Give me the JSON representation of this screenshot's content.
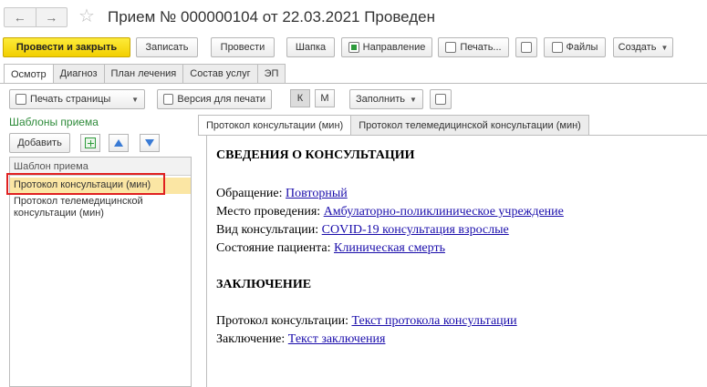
{
  "window": {
    "title": "Прием № 000000104 от 22.03.2021 Проведен"
  },
  "nav": {
    "back": "←",
    "forward": "→"
  },
  "toolbar": {
    "post_close": "Провести и закрыть",
    "save": "Записать",
    "post": "Провести",
    "header": "Шапка",
    "direction": "Направление",
    "print": "Печать...",
    "files": "Файлы",
    "create": "Создать"
  },
  "tabs": [
    "Осмотр",
    "Диагноз",
    "План лечения",
    "Состав услуг",
    "ЭП"
  ],
  "toolbar2": {
    "print_page": "Печать страницы",
    "print_version": "Версия для печати",
    "k": "К",
    "m": "М",
    "fill": "Заполнить"
  },
  "templates": {
    "title": "Шаблоны приема",
    "add": "Добавить",
    "column": "Шаблон приема",
    "items": [
      "Протокол консультации (мин)",
      "Протокол телемедицинской консультации (мин)"
    ]
  },
  "doc_tabs": [
    "Протокол консультации (мин)",
    "Протокол телемедицинской консультации (мин)"
  ],
  "document": {
    "section1": "СВЕДЕНИЯ О КОНСУЛЬТАЦИИ",
    "fields1": [
      {
        "label": "Обращение: ",
        "value": "Повторный"
      },
      {
        "label": "Место проведения: ",
        "value": "Амбулаторно-поликлиническое учреждение"
      },
      {
        "label": "Вид консультации: ",
        "value": "COVID-19 консультация взрослые"
      },
      {
        "label": "Состояние пациента: ",
        "value": "Клиническая смерть"
      }
    ],
    "section2": "ЗАКЛЮЧЕНИЕ",
    "fields2": [
      {
        "label": "Протокол консультации: ",
        "value": "Текст протокола консультации"
      },
      {
        "label": "Заключение: ",
        "value": "Текст заключения"
      }
    ]
  },
  "colors": {
    "primary_button": "#f2cf00",
    "selection": "#fbe6a4",
    "highlight_box": "#e02020",
    "link": "#1a0dab",
    "section_title": "#2e8b3a"
  }
}
